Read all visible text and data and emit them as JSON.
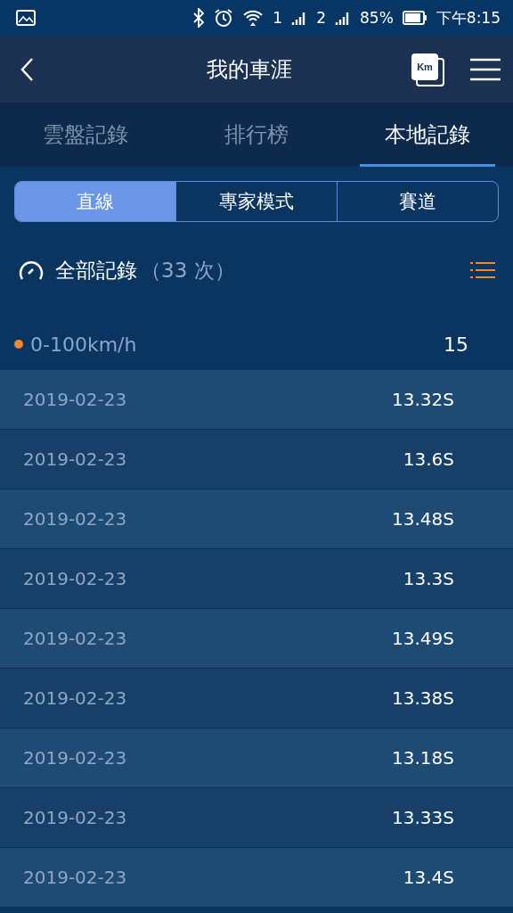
{
  "status_bar": {
    "battery": "85%",
    "time": "下午8:15",
    "sim_1": "1",
    "sim_2": "2"
  },
  "header": {
    "title": "我的車涯",
    "unit_badge": "Km"
  },
  "tabs": [
    {
      "label": "雲盤記錄",
      "selected": false
    },
    {
      "label": "排行榜",
      "selected": false
    },
    {
      "label": "本地記錄",
      "selected": true
    }
  ],
  "modes": [
    {
      "label": "直線",
      "selected": true
    },
    {
      "label": "專家模式",
      "selected": false
    },
    {
      "label": "賽道",
      "selected": false
    }
  ],
  "summary": {
    "title": "全部記錄",
    "count": "（33 次）"
  },
  "category": {
    "label": "0-100km/h",
    "count": "15",
    "color": "#f08a2c"
  },
  "records": [
    {
      "date": "2019-02-23",
      "time": "13.32S"
    },
    {
      "date": "2019-02-23",
      "time": "13.6S"
    },
    {
      "date": "2019-02-23",
      "time": "13.48S"
    },
    {
      "date": "2019-02-23",
      "time": "13.3S"
    },
    {
      "date": "2019-02-23",
      "time": "13.49S"
    },
    {
      "date": "2019-02-23",
      "time": "13.38S"
    },
    {
      "date": "2019-02-23",
      "time": "13.18S"
    },
    {
      "date": "2019-02-23",
      "time": "13.33S"
    },
    {
      "date": "2019-02-23",
      "time": "13.4S"
    }
  ]
}
